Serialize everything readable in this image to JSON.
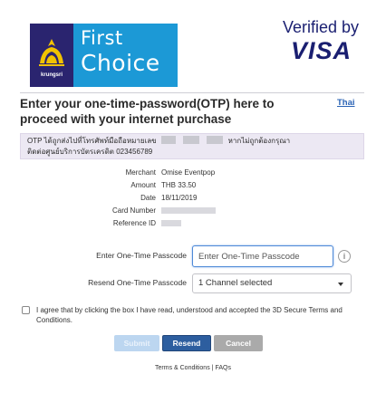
{
  "bank_logo": {
    "brand_small": "krungsri",
    "line1": "First",
    "line2": "Choice"
  },
  "scheme": {
    "verified_by": "Verified by",
    "name": "VISA",
    "color": "#1a1f71"
  },
  "title": "Enter your one-time-password(OTP) here to proceed with your internet purchase",
  "language_link": "Thai",
  "notice": {
    "prefix": "OTP ได้ถูกส่งไปที่โทรศัพท์มือถือหมายเลข",
    "suffix": "หากไม่ถูกต้องกรุณา",
    "line2": "ติดต่อศูนย์บริการบัตรเครดิต 023456789"
  },
  "details": {
    "merchant_label": "Merchant",
    "merchant_value": "Omise Eventpop",
    "amount_label": "Amount",
    "amount_value": "THB 33.50",
    "date_label": "Date",
    "date_value": "18/11/2019",
    "card_number_label": "Card Number",
    "reference_id_label": "Reference ID"
  },
  "otp": {
    "label": "Enter One-Time Passcode",
    "placeholder": "Enter One-Time Passcode",
    "value": ""
  },
  "resend": {
    "label": "Resend One-Time Passcode",
    "selected": "1 Channel selected"
  },
  "agreement": {
    "text": "I agree that by clicking the box I have read, understood and accepted the 3D Secure Terms and Conditions.",
    "checked": false
  },
  "buttons": {
    "submit": "Submit",
    "resend": "Resend",
    "cancel": "Cancel"
  },
  "footer": {
    "terms": "Terms & Conditions",
    "separator": "|",
    "faqs": "FAQs"
  },
  "colors": {
    "accent_blue": "#2d5e9f",
    "logo_purple": "#2a246f",
    "logo_blue": "#1c99d6",
    "notice_bg": "#ece8f3"
  }
}
